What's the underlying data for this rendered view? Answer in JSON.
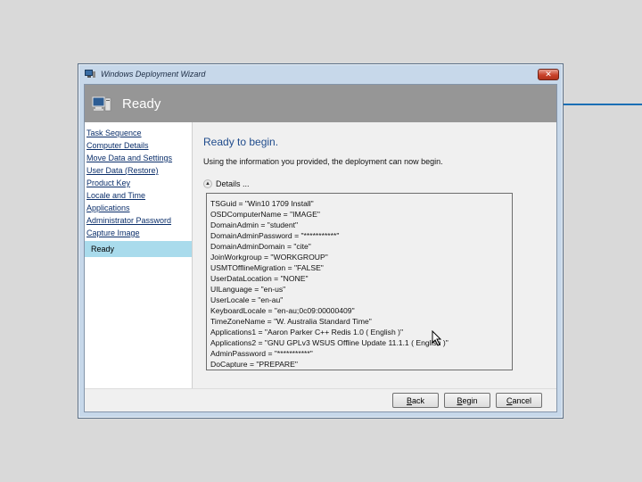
{
  "window": {
    "title": "Windows Deployment Wizard",
    "close_glyph": "✕"
  },
  "banner": {
    "title": "Ready"
  },
  "sidebar": {
    "items": [
      {
        "label": "Task Sequence"
      },
      {
        "label": "Computer Details"
      },
      {
        "label": "Move Data and Settings"
      },
      {
        "label": "User Data (Restore)"
      },
      {
        "label": "Product Key"
      },
      {
        "label": "Locale and Time"
      },
      {
        "label": "Applications"
      },
      {
        "label": "Administrator Password"
      },
      {
        "label": "Capture Image"
      }
    ],
    "active": "Ready"
  },
  "main": {
    "heading": "Ready to begin.",
    "subtext": "Using the information you provided, the deployment can now begin.",
    "details_label": "Details ...",
    "details_lines": [
      "TSGuid = \"Win10 1709 Install\"",
      "OSDComputerName = \"IMAGE\"",
      "DomainAdmin = \"student\"",
      "DomainAdminPassword = \"***********\"",
      "DomainAdminDomain = \"cite\"",
      "JoinWorkgroup = \"WORKGROUP\"",
      "USMTOfflineMigration = \"FALSE\"",
      "UserDataLocation = \"NONE\"",
      "UILanguage = \"en-us\"",
      "UserLocale = \"en-au\"",
      "KeyboardLocale = \"en-au;0c09:00000409\"",
      "TimeZoneName = \"W. Australia Standard Time\"",
      "Applications1 = \"Aaron Parker C++ Redis 1.0 ( English )\"",
      "Applications2 = \"GNU GPLv3 WSUS Offline Update 11.1.1 ( English )\"",
      "AdminPassword = \"***********\"",
      "DoCapture = \"PREPARE\""
    ]
  },
  "footer": {
    "back_label": "Back",
    "begin_label": "Begin",
    "cancel_label": "Cancel"
  },
  "colors": {
    "banner": "#969696",
    "active_item": "#a9dbec",
    "heading": "#1f4b8c",
    "accent_line": "#1a6fb5"
  }
}
